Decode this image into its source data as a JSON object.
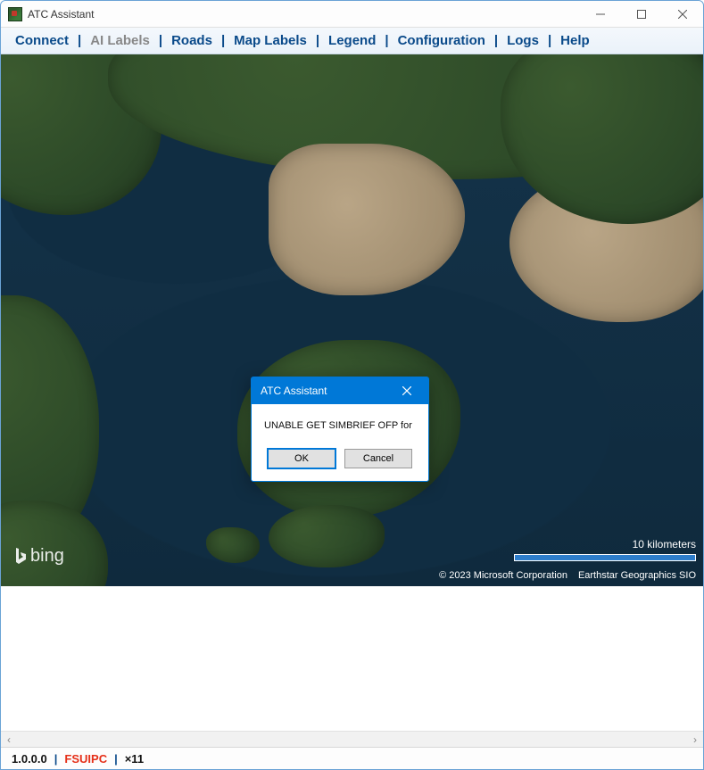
{
  "window": {
    "title": "ATC Assistant"
  },
  "menu": {
    "items": [
      {
        "label": "Connect",
        "enabled": true
      },
      {
        "label": "AI Labels",
        "enabled": false
      },
      {
        "label": "Roads",
        "enabled": true
      },
      {
        "label": "Map Labels",
        "enabled": true
      },
      {
        "label": "Legend",
        "enabled": true
      },
      {
        "label": "Configuration",
        "enabled": true
      },
      {
        "label": "Logs",
        "enabled": true
      },
      {
        "label": "Help",
        "enabled": true
      }
    ],
    "separator": "|"
  },
  "map": {
    "provider_logo": "bing",
    "scale_label": "10 kilometers",
    "attribution_copyright": "© 2023 Microsoft Corporation",
    "attribution_sources": "Earthstar Geographics  SIO"
  },
  "dialog": {
    "title": "ATC Assistant",
    "message": "UNABLE GET SIMBRIEF OFP for",
    "ok_label": "OK",
    "cancel_label": "Cancel"
  },
  "status": {
    "version": "1.0.0.0",
    "connection": "FSUIPC",
    "extra": "×11",
    "separator": "|"
  },
  "colors": {
    "menu_link": "#0a4a8a",
    "menu_disabled": "#888888",
    "dialog_accent": "#0078d7",
    "status_error": "#e53019"
  }
}
